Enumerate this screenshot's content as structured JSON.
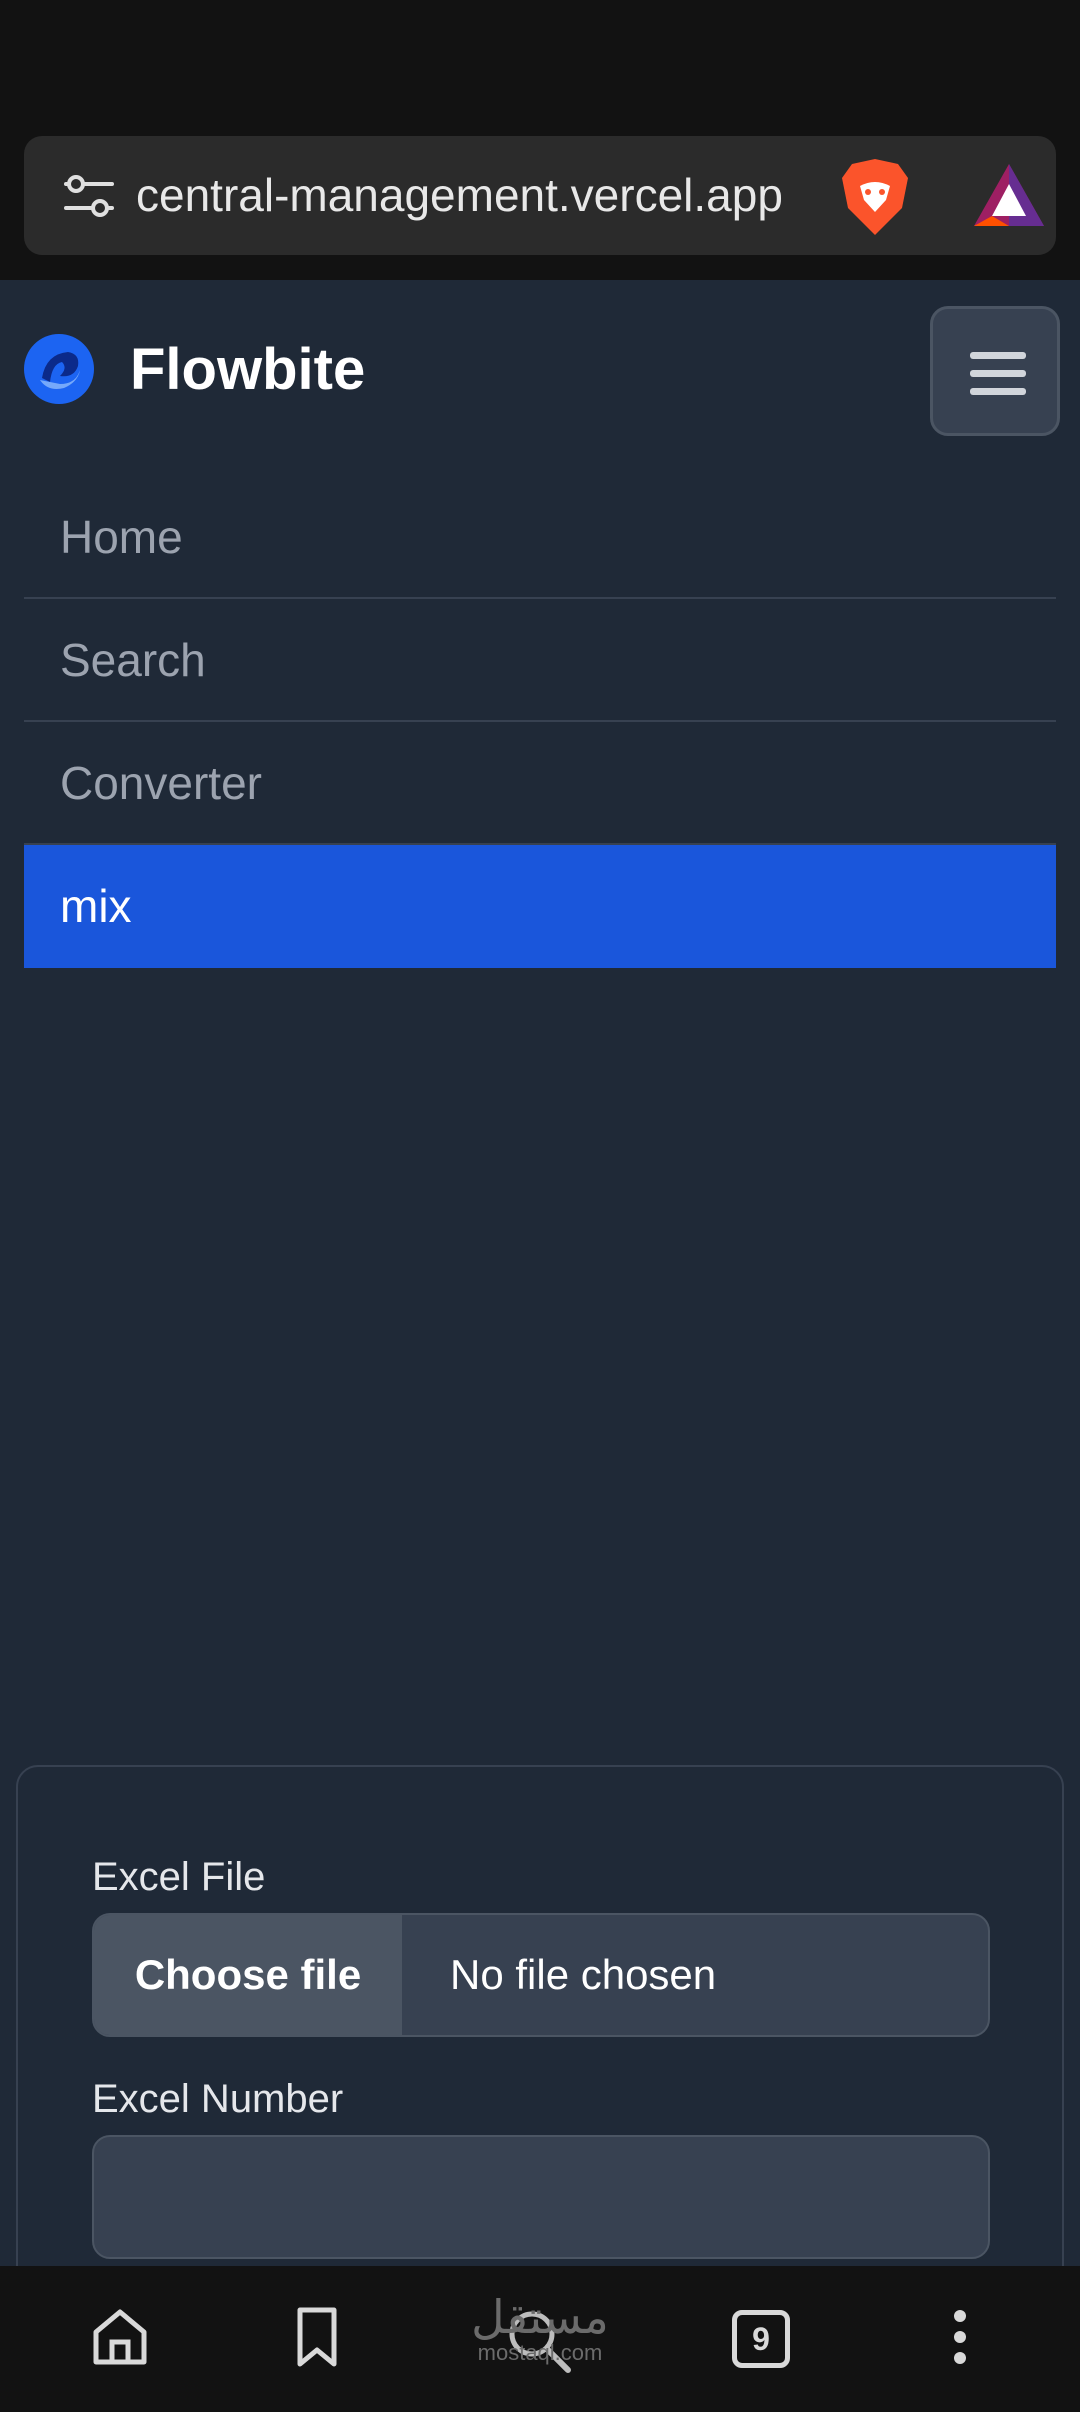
{
  "browser": {
    "url": "central-management.vercel.app",
    "tab_count": "9",
    "watermark": {
      "arabic": "مستقل",
      "latin": "mostaql.com"
    }
  },
  "header": {
    "brand": "Flowbite"
  },
  "nav": {
    "items": [
      {
        "label": "Home"
      },
      {
        "label": "Search"
      },
      {
        "label": "Converter"
      },
      {
        "label": "mix"
      }
    ],
    "active_index": 3
  },
  "form": {
    "excel_file_label": "Excel File",
    "choose_file_label": "Choose file",
    "file_status": "No file chosen",
    "excel_number_label": "Excel Number",
    "excel_number_value": ""
  },
  "colors": {
    "page_bg": "#1f2937",
    "active_nav": "#1a56db",
    "input_bg": "#374151",
    "browser_chrome": "#121212"
  }
}
